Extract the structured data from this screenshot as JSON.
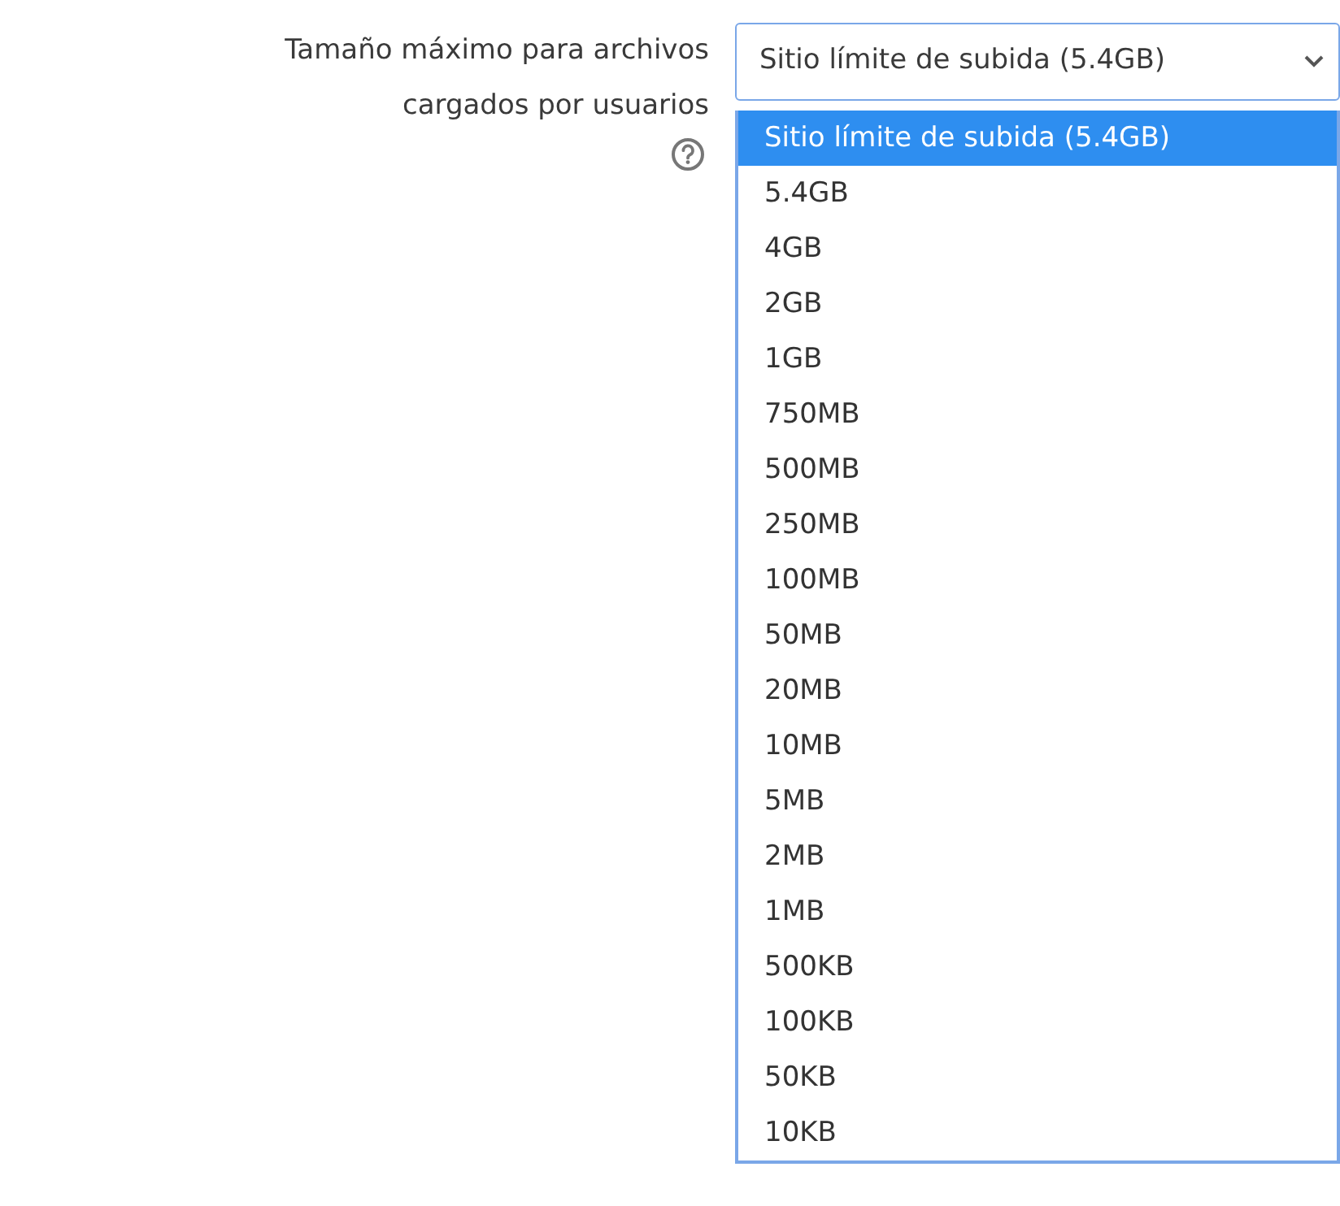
{
  "field": {
    "label_lines": [
      "Tamaño máximo para archivos",
      "cargados por usuarios"
    ],
    "value": "Sitio límite de subida (5.4GB)",
    "expanded": true
  },
  "options": [
    {
      "label": "Sitio límite de subida (5.4GB)",
      "selected": true
    },
    {
      "label": "5.4GB",
      "selected": false
    },
    {
      "label": "4GB",
      "selected": false
    },
    {
      "label": "2GB",
      "selected": false
    },
    {
      "label": "1GB",
      "selected": false
    },
    {
      "label": "750MB",
      "selected": false
    },
    {
      "label": "500MB",
      "selected": false
    },
    {
      "label": "250MB",
      "selected": false
    },
    {
      "label": "100MB",
      "selected": false
    },
    {
      "label": "50MB",
      "selected": false
    },
    {
      "label": "20MB",
      "selected": false
    },
    {
      "label": "10MB",
      "selected": false
    },
    {
      "label": "5MB",
      "selected": false
    },
    {
      "label": "2MB",
      "selected": false
    },
    {
      "label": "1MB",
      "selected": false
    },
    {
      "label": "500KB",
      "selected": false
    },
    {
      "label": "100KB",
      "selected": false
    },
    {
      "label": "50KB",
      "selected": false
    },
    {
      "label": "10KB",
      "selected": false
    }
  ]
}
